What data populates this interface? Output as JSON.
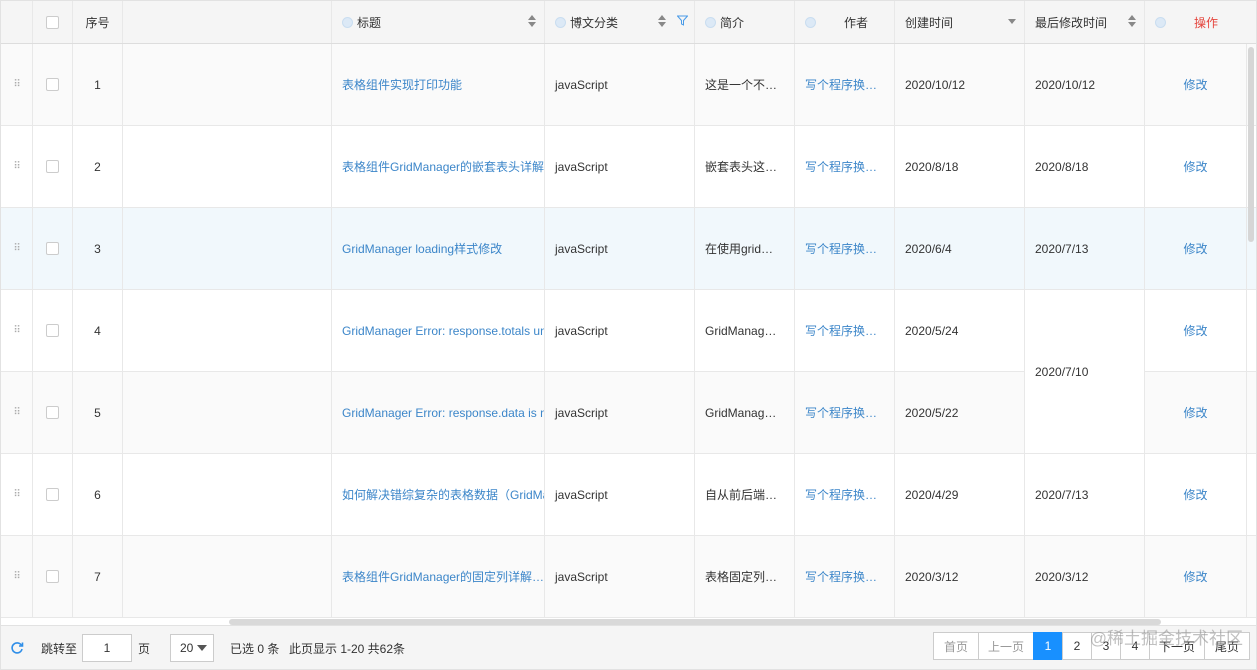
{
  "columns": {
    "order": "序号",
    "title": "标题",
    "category": "博文分类",
    "intro": "简介",
    "author": "作者",
    "created": "创建时间",
    "modified": "最后修改时间",
    "action": "操作"
  },
  "rows": [
    {
      "order": "1",
      "title": "表格组件实现打印功能",
      "category": "javaScript",
      "intro": "这是一个不…",
      "author": "写个程序换个饼…",
      "created": "2020/10/12",
      "modified": "2020/10/12",
      "action": "修改"
    },
    {
      "order": "2",
      "title": "表格组件GridManager的嵌套表头详解",
      "category": "javaScript",
      "intro": "嵌套表头这…",
      "author": "写个程序换个饼…",
      "created": "2020/8/18",
      "modified": "2020/8/18",
      "action": "修改"
    },
    {
      "order": "3",
      "title": "GridManager loading样式修改",
      "category": "javaScript",
      "intro": "在使用grid…",
      "author": "写个程序换个饼…",
      "created": "2020/6/4",
      "modified": "2020/7/13",
      "action": "修改"
    },
    {
      "order": "4",
      "title": "GridManager Error: response.totals undefined",
      "category": "javaScript",
      "intro": "GridManag…",
      "author": "写个程序换个饼…",
      "created": "2020/5/24",
      "modified": "2020/7/10",
      "action": "修改"
    },
    {
      "order": "5",
      "title": "GridManager Error: response.data is not array",
      "category": "javaScript",
      "intro": "GridManag…",
      "author": "写个程序换个饼…",
      "created": "2020/5/22",
      "modified": "",
      "action": "修改"
    },
    {
      "order": "6",
      "title": "如何解决错综复杂的表格数据（GridManager）",
      "category": "javaScript",
      "intro": "自从前后端…",
      "author": "写个程序换个饼…",
      "created": "2020/4/29",
      "modified": "2020/7/13",
      "action": "修改"
    },
    {
      "order": "7",
      "title": "表格组件GridManager的固定列详解…",
      "category": "javaScript",
      "intro": "表格固定列…",
      "author": "写个程序换个饼…",
      "created": "2020/3/12",
      "modified": "2020/3/12",
      "action": "修改"
    }
  ],
  "footer": {
    "jump_label": "跳转至",
    "jump_value": "1",
    "page_unit": "页",
    "page_size": "20",
    "selected_text": "已选 0 条",
    "range_text": "此页显示 1-20 共62条",
    "first": "首页",
    "prev": "上一页",
    "pages": [
      "1",
      "2",
      "3",
      "4"
    ],
    "next": "下一页",
    "last": "尾页"
  },
  "watermark": "@稀土掘金技术社区",
  "icons": {
    "refresh": "refresh-icon",
    "drag": "drag-handle-icon",
    "sort": "sort-icon",
    "filter": "filter-icon",
    "caret": "caret-down-icon",
    "remind": "remind-dot-icon"
  },
  "colors": {
    "link": "#3c86c9",
    "action_header": "#e5433b",
    "active_page": "#1890ff",
    "hover_row": "#f1f8fc"
  }
}
